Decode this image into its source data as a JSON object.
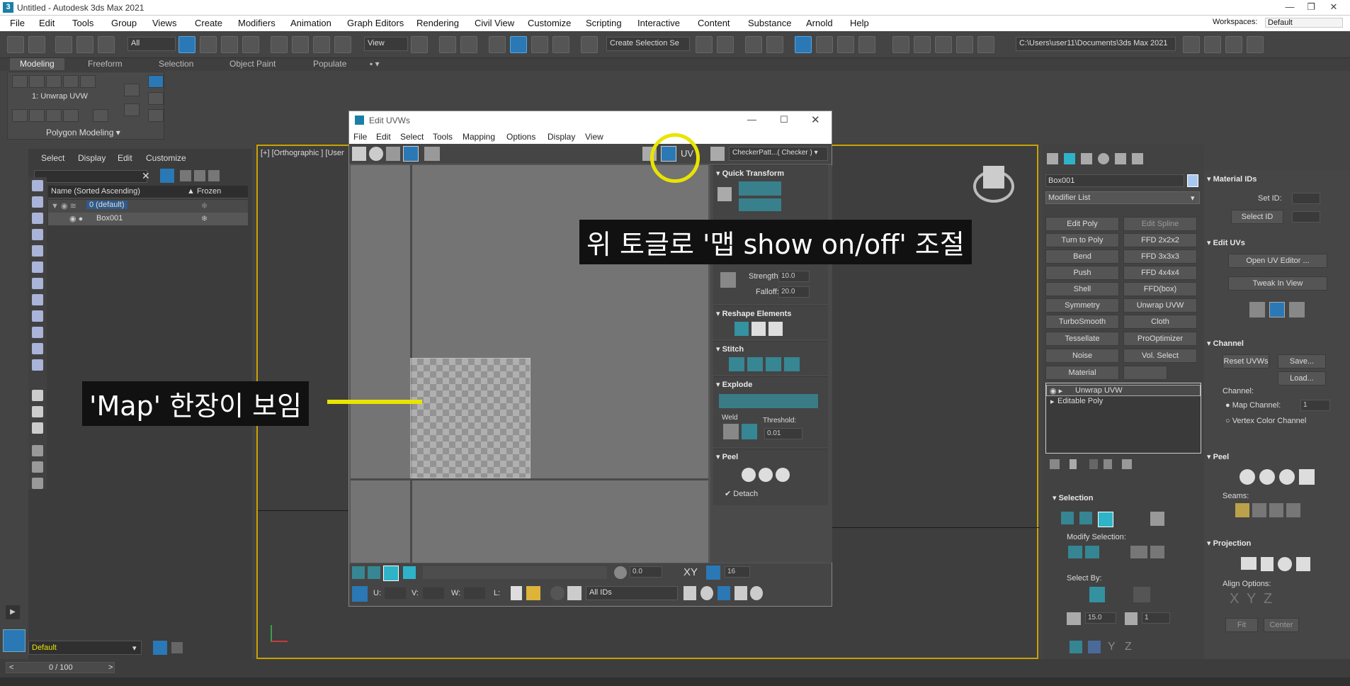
{
  "app": {
    "title": "Untitled - Autodesk 3ds Max 2021",
    "logo_char": "3",
    "window_controls": [
      "—",
      "❐",
      "✕"
    ],
    "workspaces_label": "Workspaces:",
    "workspaces_value": "Default"
  },
  "menu": [
    "File",
    "Edit",
    "Tools",
    "Group",
    "Views",
    "Create",
    "Modifiers",
    "Animation",
    "Graph Editors",
    "Rendering",
    "Civil View",
    "Customize",
    "Scripting",
    "Interactive",
    "Content",
    "Substance",
    "Arnold",
    "Help"
  ],
  "toolbar": {
    "filter_all": "All",
    "view_dropdown": "View",
    "selection_set": "Create Selection Se",
    "path": "C:\\Users\\user11\\Documents\\3ds Max 2021"
  },
  "ribbon": {
    "tabs": [
      "Modeling",
      "Freeform",
      "Selection",
      "Object Paint",
      "Populate"
    ],
    "modifier_label": "1: Unwrap UVW",
    "group_label": "Polygon Modeling"
  },
  "scene_explorer": {
    "menu": [
      "Select",
      "Display",
      "Edit",
      "Customize"
    ],
    "col_name": "Name (Sorted Ascending)",
    "col_frozen": "Frozen",
    "rows": [
      "0 (default)",
      "Box001"
    ],
    "layer_dropdown": "Default"
  },
  "viewport": {
    "label": "[+] [Orthographic ] [User"
  },
  "uvw_editor": {
    "title": "Edit UVWs",
    "menu": [
      "File",
      "Edit",
      "Select",
      "Tools",
      "Mapping",
      "Options",
      "Display",
      "View"
    ],
    "uv_label": "UV",
    "checker_dropdown": "CheckerPatt...( Checker )",
    "quick_transform": "Quick Transform",
    "strength_label": "Strength:",
    "strength_value": "10.0",
    "falloff_label": "Falloff:",
    "falloff_value": "20.0",
    "reshape": "Reshape Elements",
    "stitch": "Stitch",
    "explode": "Explode",
    "weld": "Weld",
    "threshold_label": "Threshold:",
    "threshold_value": "0.01",
    "peel": "Peel",
    "detach": "Detach",
    "zoom_value": "0.0",
    "xy_label": "XY",
    "grid_value": "16",
    "u_label": "U:",
    "v_label": "V:",
    "w_label": "W:",
    "l_label": "L:",
    "ids_dropdown": "All IDs"
  },
  "annotations": {
    "toggle_note": "위 토글로 '맵 show on/off' 조절",
    "map_note": "'Map' 한장이 보임"
  },
  "command_panel": {
    "object_name": "Box001",
    "modifier_list": "Modifier List",
    "buttons": [
      "Edit Poly",
      "Edit Spline",
      "Turn to Poly",
      "FFD 2x2x2",
      "Bend",
      "FFD 3x3x3",
      "Push",
      "FFD 4x4x4",
      "Shell",
      "FFD(box)",
      "Symmetry",
      "Unwrap UVW",
      "TurboSmooth",
      "Cloth",
      "Tessellate",
      "ProOptimizer",
      "Noise",
      "Vol. Select",
      "Material",
      ""
    ],
    "stack": [
      "Unwrap UVW",
      "Editable Poly"
    ],
    "selection_title": "Selection",
    "modify_selection": "Modify Selection:",
    "select_by": "Select By:",
    "angle_value": "15.0",
    "count_value": "1"
  },
  "right_panel": {
    "material_ids": "Material IDs",
    "set_id": "Set ID:",
    "select_id": "Select ID",
    "edit_uvs": "Edit UVs",
    "open_uv_editor": "Open UV Editor ...",
    "tweak_in_view": "Tweak In View",
    "channel": "Channel",
    "reset_uvws": "Reset UVWs",
    "save": "Save...",
    "load": "Load...",
    "channel_label": "Channel:",
    "map_channel": "Map Channel:",
    "map_channel_value": "1",
    "vertex_color_channel": "Vertex Color Channel",
    "peel": "Peel",
    "seams": "Seams:",
    "projection": "Projection",
    "align_options": "Align Options:",
    "align_x": "X",
    "align_y": "Y",
    "align_z": "Z",
    "fit": "Fit",
    "center": "Center"
  },
  "status": {
    "frame": "0 / 100"
  }
}
